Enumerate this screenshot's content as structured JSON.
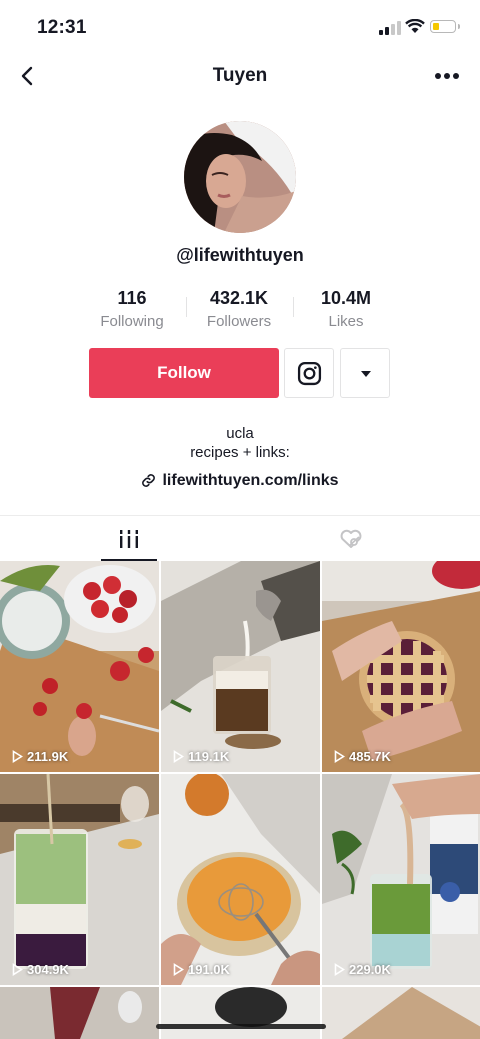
{
  "status_bar": {
    "time": "12:31"
  },
  "header": {
    "title": "Tuyen",
    "back_icon": "chevron-left-icon",
    "more_icon": "ellipsis-icon"
  },
  "profile": {
    "handle": "@lifewithtuyen",
    "stats": [
      {
        "value": "116",
        "label": "Following"
      },
      {
        "value": "432.1K",
        "label": "Followers"
      },
      {
        "value": "10.4M",
        "label": "Likes"
      }
    ],
    "follow_label": "Follow",
    "bio_line1": "ucla",
    "bio_line2": "recipes + links:",
    "link": "lifewithtuyen.com/links"
  },
  "tabs": [
    {
      "name": "videos",
      "icon": "grid-icon",
      "active": true
    },
    {
      "name": "liked",
      "icon": "liked-hidden-icon",
      "active": false
    }
  ],
  "videos": [
    {
      "views": "211.9K",
      "subject": "strawberries"
    },
    {
      "views": "119.1K",
      "subject": "iced coffee"
    },
    {
      "views": "485.7K",
      "subject": "lattice pie"
    },
    {
      "views": "304.9K",
      "subject": "matcha berry latte"
    },
    {
      "views": "191.0K",
      "subject": "whisking batter"
    },
    {
      "views": "229.0K",
      "subject": "matcha latte"
    }
  ],
  "colors": {
    "follow": "#ea3e58",
    "text": "#161823",
    "muted": "#8a8b91"
  }
}
